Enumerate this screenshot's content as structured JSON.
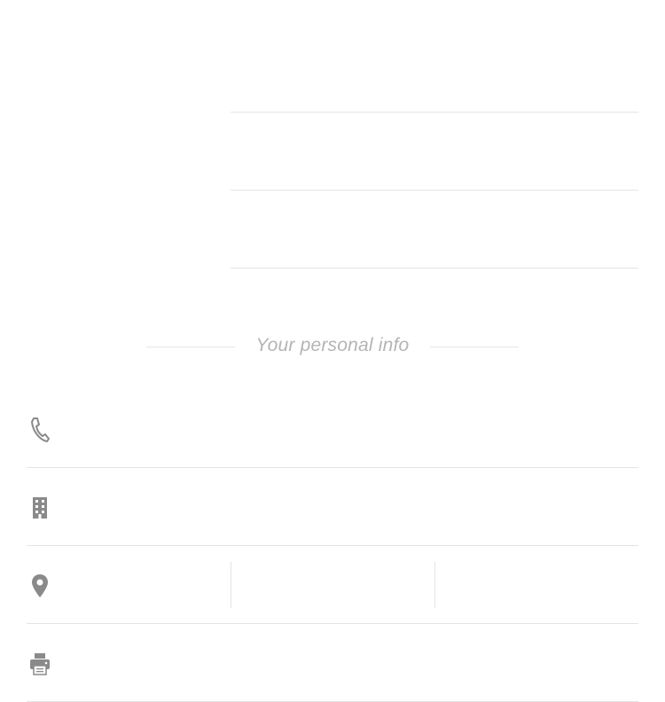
{
  "form": {
    "fields": [
      {
        "value": "",
        "placeholder": ""
      },
      {
        "value": "",
        "placeholder": ""
      },
      {
        "value": "",
        "placeholder": ""
      }
    ]
  },
  "personal_info": {
    "section_title": "Your personal info",
    "phone": {
      "icon": "phone-icon",
      "value": "",
      "placeholder": ""
    },
    "company": {
      "icon": "building-icon",
      "value": "",
      "placeholder": ""
    },
    "location": {
      "icon": "map-pin-icon",
      "city": {
        "value": "",
        "placeholder": ""
      },
      "state": {
        "value": "",
        "placeholder": ""
      },
      "zip": {
        "value": "",
        "placeholder": ""
      }
    },
    "fax": {
      "icon": "printer-icon",
      "value": "",
      "placeholder": ""
    }
  },
  "colors": {
    "icon": "#8a8a8a",
    "divider": "#e4e4e4",
    "section_title": "#b4b4b4"
  }
}
